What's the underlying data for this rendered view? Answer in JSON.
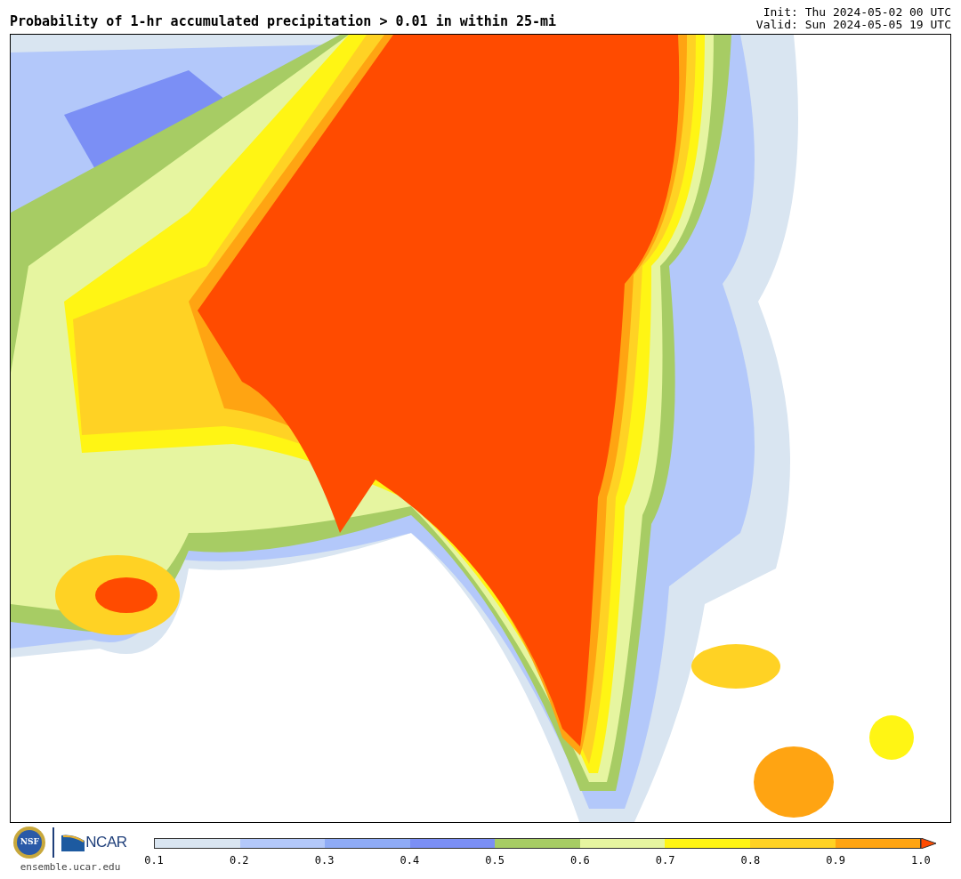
{
  "title": "Probability of 1-hr accumulated precipitation > 0.01 in within 25-mi",
  "init": "Init: Thu 2024-05-02 00 UTC",
  "valid": "Valid: Sun 2024-05-05 19 UTC",
  "logos": {
    "nsf_text": "NSF",
    "ncar_text": "NCAR",
    "url": "ensemble.ucar.edu"
  },
  "colorbar": {
    "bins": [
      {
        "color": "#d9e5f1"
      },
      {
        "color": "#b3c8fa"
      },
      {
        "color": "#8fabf6"
      },
      {
        "color": "#7b8ff5"
      },
      {
        "color": "#a7cc64"
      },
      {
        "color": "#e6f5a0"
      },
      {
        "color": "#fff514"
      },
      {
        "color": "#ffd224"
      },
      {
        "color": "#ffa412"
      }
    ],
    "extend_arrow": {
      "color": "#ff4b00"
    },
    "ticks": [
      "0.1",
      "0.2",
      "0.3",
      "0.4",
      "0.5",
      "0.6",
      "0.7",
      "0.8",
      "0.9",
      "1.0"
    ]
  }
}
